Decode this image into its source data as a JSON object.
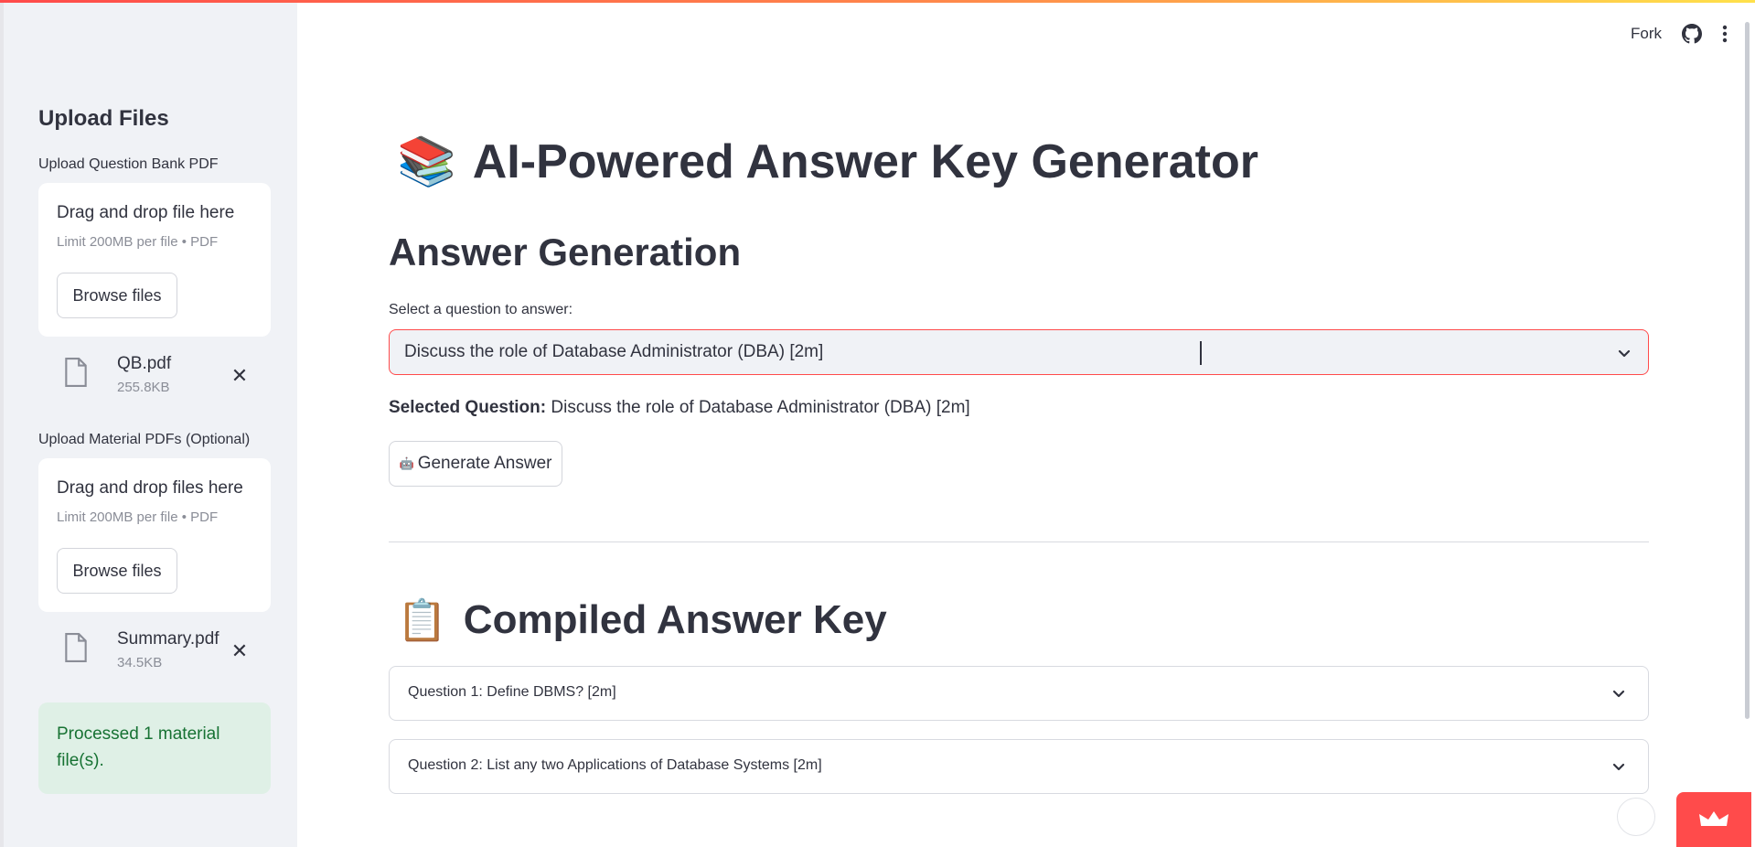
{
  "sidebar": {
    "title": "Upload Files",
    "qb_uploader": {
      "label": "Upload Question Bank PDF",
      "drop_text": "Drag and drop file here",
      "limit_text": "Limit 200MB per file • PDF",
      "browse_label": "Browse files",
      "file": {
        "name": "QB.pdf",
        "size": "255.8KB"
      }
    },
    "material_uploader": {
      "label": "Upload Material PDFs (Optional)",
      "drop_text": "Drag and drop files here",
      "limit_text": "Limit 200MB per file • PDF",
      "browse_label": "Browse files",
      "file": {
        "name": "Summary.pdf",
        "size": "34.5KB"
      }
    },
    "success_message": "Processed 1 material file(s)."
  },
  "header": {
    "fork_label": "Fork",
    "github_icon": "github-icon",
    "menu_icon": "kebab-menu-icon"
  },
  "main": {
    "title_emoji": "📚",
    "title": "AI-Powered Answer Key Generator",
    "section_title": "Answer Generation",
    "select_label": "Select a question to answer:",
    "select_value": "Discuss the role of Database Administrator (DBA) [2m]",
    "selected_question_label": "Selected Question:",
    "selected_question_value": "Discuss the role of Database Administrator (DBA) [2m]",
    "generate_icon": "🤖",
    "generate_label": "Generate Answer",
    "compiled_emoji": "📋",
    "compiled_title": "Compiled Answer Key",
    "expanders": [
      {
        "label": "Question 1: Define DBMS? [2m]"
      },
      {
        "label": "Question 2: List any two Applications of Database Systems [2m]"
      }
    ]
  },
  "colors": {
    "accent": "#ff4b4b",
    "sidebar_bg": "#f0f2f6",
    "success_bg": "#dff0e6",
    "success_text": "#177233"
  }
}
